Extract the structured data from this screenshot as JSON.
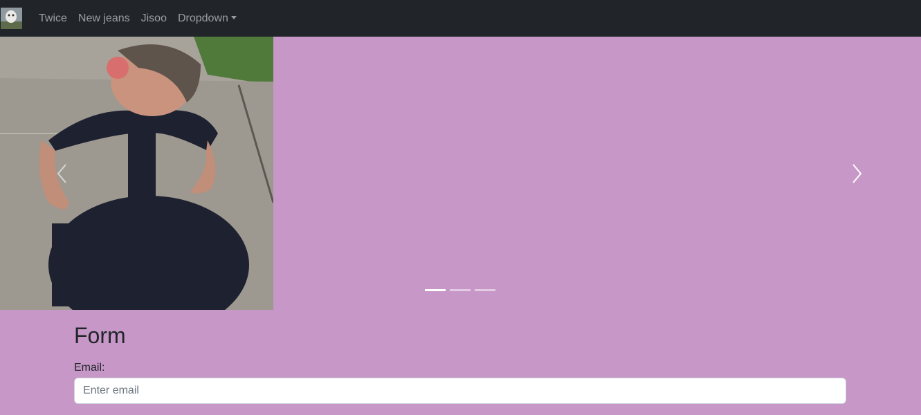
{
  "navbar": {
    "brand_icon": "brand-logo-icon",
    "links": [
      {
        "label": "Twice"
      },
      {
        "label": "New jeans"
      },
      {
        "label": "Jisoo"
      },
      {
        "label": "Dropdown"
      }
    ]
  },
  "carousel": {
    "current_slide": 1,
    "slide_count": 3,
    "prev_icon": "chevron-left-icon",
    "next_icon": "chevron-right-icon"
  },
  "form": {
    "title": "Form",
    "email_label": "Email:",
    "email_placeholder": "Enter email",
    "email_value": ""
  },
  "colors": {
    "navbar_bg": "#212529",
    "page_bg": "#c797c8"
  }
}
